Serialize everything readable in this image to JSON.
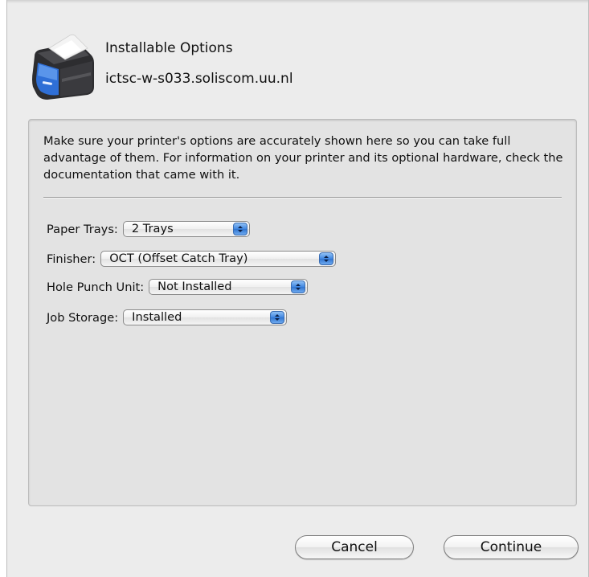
{
  "header": {
    "title": "Installable Options",
    "subtitle": "ictsc-w-s033.soliscom.uu.nl",
    "icon": "printer-icon"
  },
  "panel": {
    "description": "Make sure your printer's options are accurately shown here so you can take full advantage of them.  For information on your printer and its optional hardware, check the documentation that came with it."
  },
  "options": [
    {
      "label": "Paper Trays:",
      "value": "2 Trays"
    },
    {
      "label": "Finisher:",
      "value": "OCT (Offset Catch Tray)"
    },
    {
      "label": "Hole Punch Unit:",
      "value": "Not Installed"
    },
    {
      "label": "Job Storage:",
      "value": "Installed"
    }
  ],
  "buttons": {
    "cancel": "Cancel",
    "continue": "Continue"
  },
  "colors": {
    "sheet_bg": "#ececec",
    "panel_bg": "#e3e3e3",
    "popup_arrow_blue": "#3f86e0"
  }
}
